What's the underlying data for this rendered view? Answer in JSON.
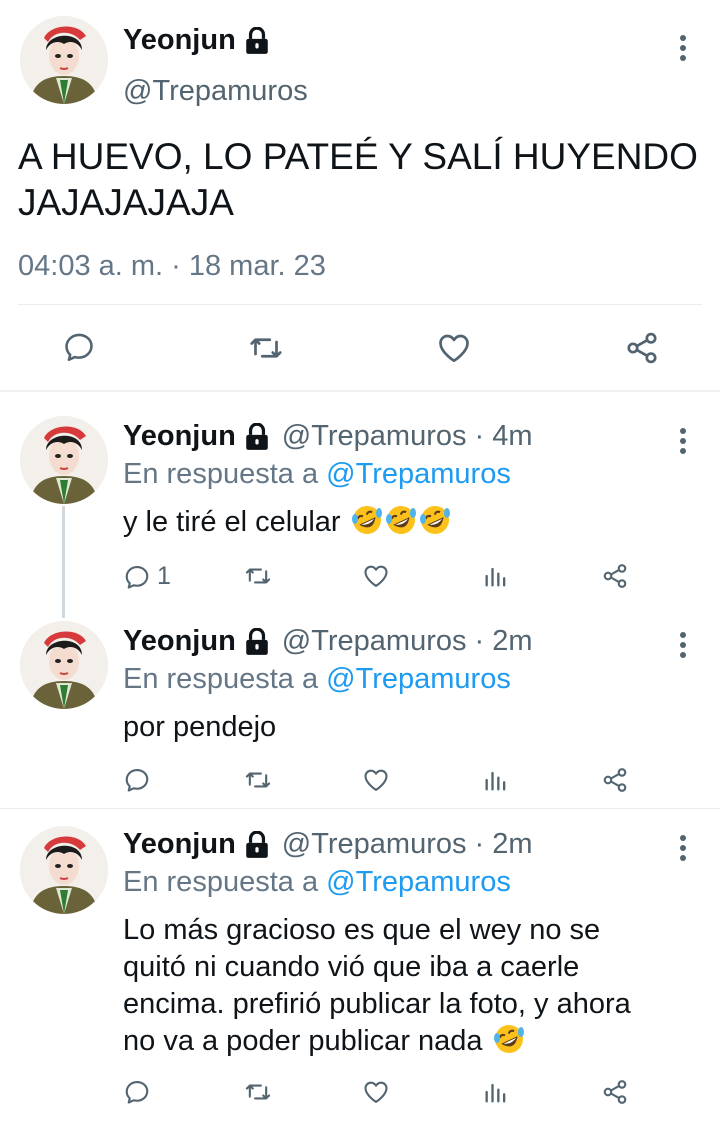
{
  "main_tweet": {
    "name": "Yeonjun",
    "handle": "@Trepamuros",
    "text_line1": "A HUEVO, LO PATEÉ Y SALÍ HUYENDO",
    "text_line2": "JAJAJAJAJA",
    "timestamp": "04:03 a. m. · 18 mar. 23"
  },
  "replies": [
    {
      "name": "Yeonjun",
      "handle": "@Trepamuros",
      "time": "· 4m",
      "reply_prefix": "En respuesta a",
      "reply_to": "@Trepamuros",
      "text": "y le tiré el celular",
      "reply_count": "1"
    },
    {
      "name": "Yeonjun",
      "handle": "@Trepamuros",
      "time": "· 2m",
      "reply_prefix": "En respuesta a",
      "reply_to": "@Trepamuros",
      "text": "por pendejo"
    },
    {
      "name": "Yeonjun",
      "handle": "@Trepamuros",
      "time": "· 2m",
      "reply_prefix": "En respuesta a",
      "reply_to": "@Trepamuros",
      "text_line1": "Lo más gracioso es que el wey no se",
      "text_line2": "quitó ni cuando vió que iba a caerle",
      "text_line3": "encima. prefirió publicar la foto, y ahora",
      "text_line4": "no va a poder publicar nada"
    }
  ],
  "icons": {
    "reply": "reply-icon",
    "retweet": "retweet-icon",
    "like": "heart-icon",
    "analytics": "analytics-icon",
    "share": "share-icon",
    "lock": "lock-icon",
    "more": "more-icon",
    "emoji": "rolling-on-floor-laughing-emoji"
  },
  "colors": {
    "link": "#1d9bf0",
    "muted": "#536471",
    "text": "#0f1419",
    "divider": "#e6ecf0"
  }
}
